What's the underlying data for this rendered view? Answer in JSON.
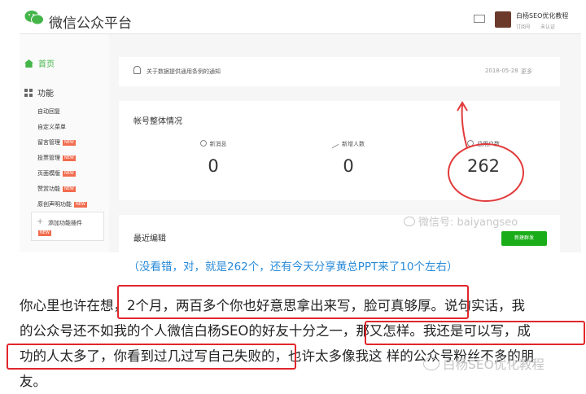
{
  "app": {
    "title": "微信公众平台"
  },
  "account": {
    "name": "白杨SEO优化教程",
    "sub": [
      "订阅号",
      "未认证"
    ]
  },
  "sidebar": {
    "home_label": "首页",
    "section_label": "功能",
    "items": [
      {
        "label": "自动回复",
        "new": ""
      },
      {
        "label": "自定义菜单",
        "new": ""
      },
      {
        "label": "留言管理",
        "new": "NEW"
      },
      {
        "label": "投票管理",
        "new": "NEW"
      },
      {
        "label": "页面模版",
        "new": "NEW"
      },
      {
        "label": "赞赏功能",
        "new": "NEW"
      },
      {
        "label": "原创声明功能",
        "new": "NEW"
      }
    ],
    "add_plugin": {
      "label": "添加功能插件",
      "new": "NEW"
    }
  },
  "notice": {
    "text": "关于数据提供通用条例的通知",
    "date": "2018-05-28",
    "close": "更多"
  },
  "stats": {
    "title": "帐号整体情况",
    "items": [
      {
        "label": "新消息",
        "value": "0"
      },
      {
        "label": "新增人数",
        "value": "0"
      },
      {
        "label": "总用户数",
        "value": "262"
      }
    ]
  },
  "recent": {
    "title": "最近编辑",
    "button": "新建群发"
  },
  "watermark1": "微信号: baiyangseo",
  "caption": "（没看错，对，就是262个，还有今天分享黄总PPT来了10个左右）",
  "paragraph": [
    "你心里也许在想，2个月，两百多个你也好意思拿出来写，脸可真够厚。说句实话，我",
    "的公众号还不如我的个人微信白杨SEO的好友十分之一，那又怎样。我还是可以写，成",
    "功的人太多了，你看到过几过写自己失败的，也许太多像我这 样的公众号粉丝不多的朋",
    "友。"
  ],
  "watermark2": "白杨SEO优化教程",
  "colors": {
    "accent": "#44b549",
    "annotation": "#e1262c",
    "caption": "#2a8bd8"
  }
}
